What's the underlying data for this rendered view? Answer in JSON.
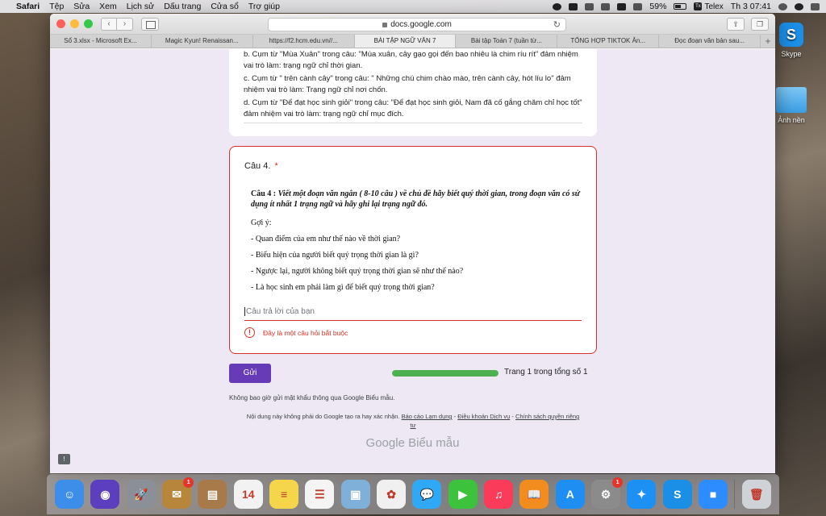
{
  "menubar": {
    "items": [
      "Safari",
      "Tệp",
      "Sửa",
      "Xem",
      "Lịch sử",
      "Dấu trang",
      "Cửa sổ",
      "Trợ giúp"
    ],
    "battery": "59%",
    "input_method": "Telex",
    "clock": "Th 3 07:41"
  },
  "desktop": {
    "skype_label": "Skype",
    "folder_label": "Ảnh nền"
  },
  "browser": {
    "url": "docs.google.com",
    "tabs": [
      "Sổ 3.xlsx - Microsoft Ex...",
      "Magic Kyun! Renaissan...",
      "https://f2.hcm.edu.vn//...",
      "BÀI TẬP NGỮ VĂN 7",
      "Bài tập Toán 7 (tuần từ...",
      "TỔNG HỢP TIKTOK Ăn...",
      "Đọc đoạn văn bản sau..."
    ],
    "active_tab": 3,
    "new_tab": "+"
  },
  "previous_answer": {
    "lines": [
      "b. Cụm từ \"Mùa Xuân\" trong câu: \"Mùa xuân, cây gạo gọi đến bao nhiêu là chim ríu rít\" đảm nhiệm vai trò làm: trạng ngữ chỉ thời gian.",
      "c. Cụm từ \" trên cành cây\" trong câu: \" Những chú chim chào mào, trên cành cây, hót líu lo\" đảm nhiệm vai trò làm: Trạng ngữ chỉ nơi chốn.",
      "d. Cụm từ \"Để đạt học sinh giỏi\" trong câu: \"Để đạt học sinh giỏi, Nam đã cố gắng chăm chỉ học tốt\" đảm nhiệm vai trò làm: trạng ngữ chỉ mục đích."
    ]
  },
  "question": {
    "title": "Câu 4.",
    "required_mark": "*",
    "prompt_label": "Câu 4 :",
    "prompt_text": "Viết một đoạn văn ngắn ( 8-10 câu ) về chủ đề hãy biết quý thời gian, trong đoạn văn có sử dụng ít nhất 1 trạng ngữ và hãy ghi lại trạng ngữ đó.",
    "hint_label": "Gợi ý:",
    "hints": [
      "- Quan điểm của em như thế nào về thời gian?",
      "- Biểu hiện của người biết quý trọng thời gian là gì?",
      "- Ngược lại, người không biết quý trọng thời gian sẽ như thế nào?",
      "- Là học sinh em phải làm gì để biết quý trọng thời gian?"
    ],
    "answer_placeholder": "Câu trả lời của bạn",
    "error_text": "Đây là một câu hỏi bắt buộc"
  },
  "form": {
    "submit_label": "Gửi",
    "progress_fraction": 1.0,
    "page_label": "Trang 1 trong tổng số 1",
    "password_notice": "Không bao giờ gửi mật khẩu thông qua Google Biểu mẫu.",
    "footer_text": "Nội dung này không phải do Google tạo ra hay xác nhận.",
    "footer_links": [
      "Báo cáo Lạm dụng",
      "Điều khoản Dịch vụ",
      "Chính sách quyền riêng tư"
    ],
    "logo_google": "Google",
    "logo_forms": "Biểu mẫu"
  },
  "dock": {
    "apps": [
      {
        "name": "finder-icon",
        "color": "#3d8ee8",
        "glyph": "☺"
      },
      {
        "name": "siri-icon",
        "color": "#5b3fbf",
        "glyph": "◉"
      },
      {
        "name": "launchpad-icon",
        "color": "#8a8f98",
        "glyph": "🚀"
      },
      {
        "name": "mail-stamp-icon",
        "color": "#b8863b",
        "glyph": "✉",
        "badge": "1"
      },
      {
        "name": "contacts-icon",
        "color": "#a87a4a",
        "glyph": "▤"
      },
      {
        "name": "calendar-icon",
        "color": "#f2f2f2",
        "glyph": "14"
      },
      {
        "name": "notes-icon",
        "color": "#f5d54a",
        "glyph": "≡"
      },
      {
        "name": "reminders-icon",
        "color": "#f4f4f4",
        "glyph": "☰"
      },
      {
        "name": "preview-icon",
        "color": "#7fb0d9",
        "glyph": "▣"
      },
      {
        "name": "photos-icon",
        "color": "#f0f0f0",
        "glyph": "✿"
      },
      {
        "name": "messages-icon",
        "color": "#2fa8f5",
        "glyph": "💬"
      },
      {
        "name": "facetime-icon",
        "color": "#3cc23c",
        "glyph": "▶"
      },
      {
        "name": "music-icon",
        "color": "#fa3c5a",
        "glyph": "♫"
      },
      {
        "name": "books-icon",
        "color": "#f28c1e",
        "glyph": "📖"
      },
      {
        "name": "app-store-icon",
        "color": "#1e8ef2",
        "glyph": "A"
      },
      {
        "name": "system-preferences-icon",
        "color": "#8b8b8b",
        "glyph": "⚙",
        "badge": "1"
      },
      {
        "name": "safari-icon",
        "color": "#1c90f3",
        "glyph": "✦"
      },
      {
        "name": "skype-icon",
        "color": "#1b8ee6",
        "glyph": "S"
      },
      {
        "name": "zoom-icon",
        "color": "#2d8cff",
        "glyph": "■"
      }
    ],
    "trash": {
      "name": "trash-icon",
      "color": "#cfd3d8",
      "glyph": "🗑"
    }
  }
}
